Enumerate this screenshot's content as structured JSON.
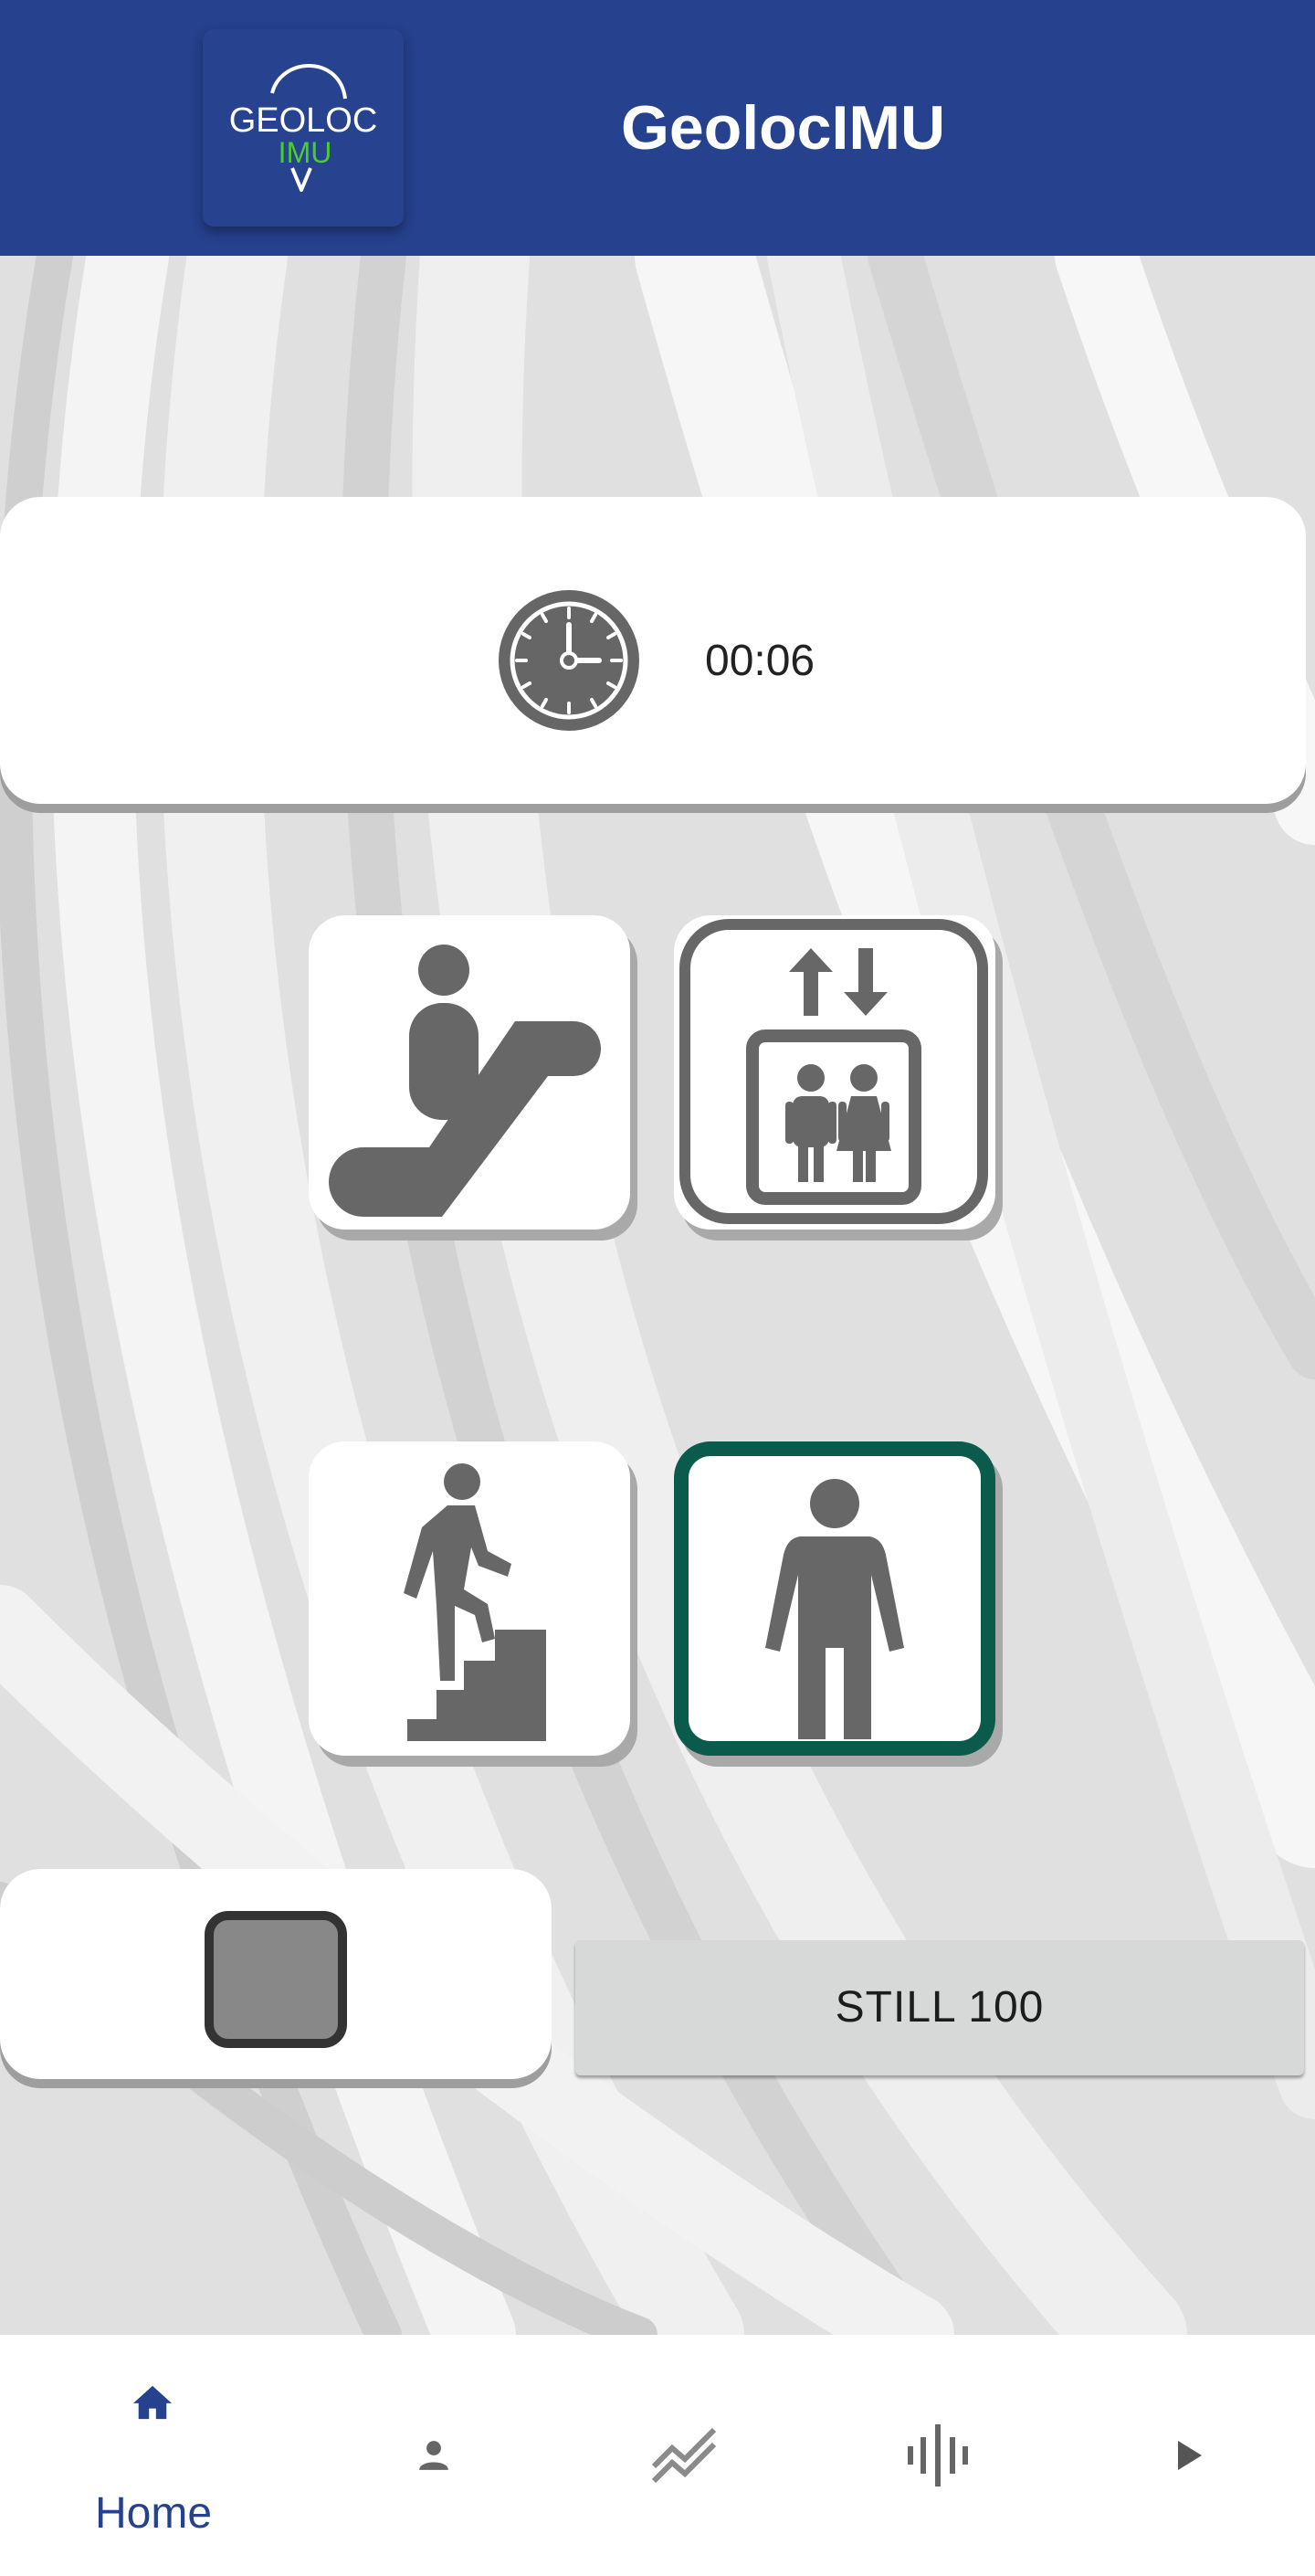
{
  "header": {
    "title": "GeolocIMU",
    "logo": {
      "line1": "GEOLOC",
      "line2": "IMU",
      "icon": "geoloc-pin-logo"
    }
  },
  "timer": {
    "icon": "clock-icon",
    "value": "00:06"
  },
  "activities": [
    {
      "name": "escalator",
      "icon": "escalator-icon",
      "selected": false
    },
    {
      "name": "elevator",
      "icon": "elevator-icon",
      "selected": false
    },
    {
      "name": "stairs",
      "icon": "stairs-icon",
      "selected": false
    },
    {
      "name": "still",
      "icon": "standing-person-icon",
      "selected": true
    }
  ],
  "controls": {
    "stop_icon": "stop-icon"
  },
  "status": {
    "text": "STILL 100"
  },
  "nav": {
    "items": [
      {
        "label": "Home",
        "icon": "home-icon",
        "active": true
      },
      {
        "label": "",
        "icon": "person-icon",
        "active": false
      },
      {
        "label": "",
        "icon": "trend-chart-icon",
        "active": false
      },
      {
        "label": "",
        "icon": "waveform-icon",
        "active": false
      },
      {
        "label": "",
        "icon": "play-icon",
        "active": false
      }
    ]
  },
  "colors": {
    "header_bg": "#26418d",
    "selected_border": "#0a5b4b",
    "icon_gray": "#666666",
    "logo_green": "#4ccd2f",
    "nav_active": "#26418d"
  }
}
